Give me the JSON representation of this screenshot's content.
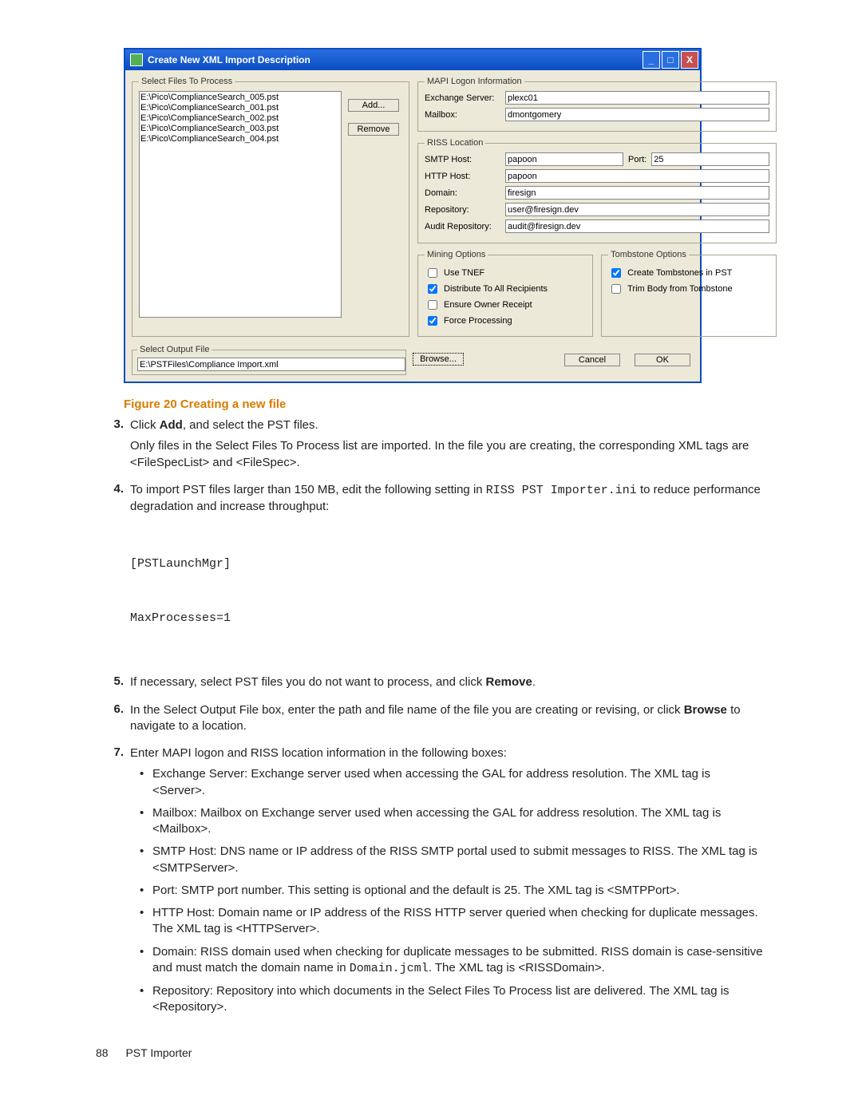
{
  "dialog": {
    "title": "Create New XML Import Description",
    "groups": {
      "select_files": "Select Files To Process",
      "mapi": "MAPI Logon Information",
      "riss": "RISS Location",
      "mining": "Mining Options",
      "tombstone": "Tombstone Options",
      "output": "Select Output File"
    },
    "files": [
      "E:\\Pico\\ComplianceSearch_005.pst",
      "E:\\Pico\\ComplianceSearch_001.pst",
      "E:\\Pico\\ComplianceSearch_002.pst",
      "E:\\Pico\\ComplianceSearch_003.pst",
      "E:\\Pico\\ComplianceSearch_004.pst"
    ],
    "buttons": {
      "add": "Add...",
      "remove": "Remove",
      "browse": "Browse...",
      "cancel": "Cancel",
      "ok": "OK"
    },
    "mapi": {
      "exchange_label": "Exchange Server:",
      "exchange_value": "plexc01",
      "mailbox_label": "Mailbox:",
      "mailbox_value": "dmontgomery"
    },
    "riss": {
      "smtp_label": "SMTP Host:",
      "smtp_value": "papoon",
      "port_label": "Port:",
      "port_value": "25",
      "http_label": "HTTP Host:",
      "http_value": "papoon",
      "domain_label": "Domain:",
      "domain_value": "firesign",
      "repo_label": "Repository:",
      "repo_value": "user@firesign.dev",
      "audit_label": "Audit Repository:",
      "audit_value": "audit@firesign.dev"
    },
    "mining": {
      "use_tnef": "Use TNEF",
      "distribute": "Distribute To All Recipients",
      "ensure_owner": "Ensure Owner Receipt",
      "force": "Force Processing"
    },
    "tombstone": {
      "create": "Create Tombstones in PST",
      "trim": "Trim Body from Tombstone"
    },
    "output_value": "E:\\PSTFiles\\Compliance Import.xml"
  },
  "caption": "Figure 20 Creating a new file",
  "steps": {
    "s3": {
      "n": "3.",
      "line1a": "Click ",
      "line1b": "Add",
      "line1c": ", and select the PST files.",
      "line2": "Only files in the Select Files To Process list are imported. In the file you are creating, the corresponding XML tags are <FileSpecList> and <FileSpec>."
    },
    "s4": {
      "n": "4.",
      "line1a": "To import PST files larger than 150 MB, edit the following setting in ",
      "line1code": "RISS PST Importer.ini",
      "line1b": " to reduce performance degradation and increase throughput:",
      "code1": "[PSTLaunchMgr]",
      "code2": "MaxProcesses=1"
    },
    "s5": {
      "n": "5.",
      "line1a": "If necessary, select PST files you do not want to process, and click ",
      "line1b": "Remove",
      "line1c": "."
    },
    "s6": {
      "n": "6.",
      "line1a": "In the Select Output File box, enter the path and file name of the file you are creating or revising, or click ",
      "line1b": "Browse",
      "line1c": " to navigate to a location."
    },
    "s7": {
      "n": "7.",
      "line1": "Enter MAPI logon and RISS location information in the following boxes:",
      "b1": "Exchange Server: Exchange server used when accessing the GAL for address resolution. The XML tag is <Server>.",
      "b2": "Mailbox: Mailbox on Exchange server used when accessing the GAL for address resolution. The XML tag is <Mailbox>.",
      "b3": "SMTP Host: DNS name or IP address of the RISS SMTP portal used to submit messages to RISS. The XML tag is <SMTPServer>.",
      "b4": "Port: SMTP port number. This setting is optional and the default is 25. The XML tag is <SMTPPort>.",
      "b5": "HTTP Host: Domain name or IP address of the RISS HTTP server queried when checking for duplicate messages. The XML tag is <HTTPServer>.",
      "b6a": "Domain: RISS domain used when checking for duplicate messages to be submitted. RISS domain is case-sensitive and must match the domain name in ",
      "b6code": "Domain.jcml",
      "b6b": ". The XML tag is <RISSDomain>.",
      "b7": "Repository: Repository into which documents in the Select Files To Process list are delivered. The XML tag is <Repository>."
    }
  },
  "footer": {
    "page": "88",
    "section": "PST Importer"
  }
}
